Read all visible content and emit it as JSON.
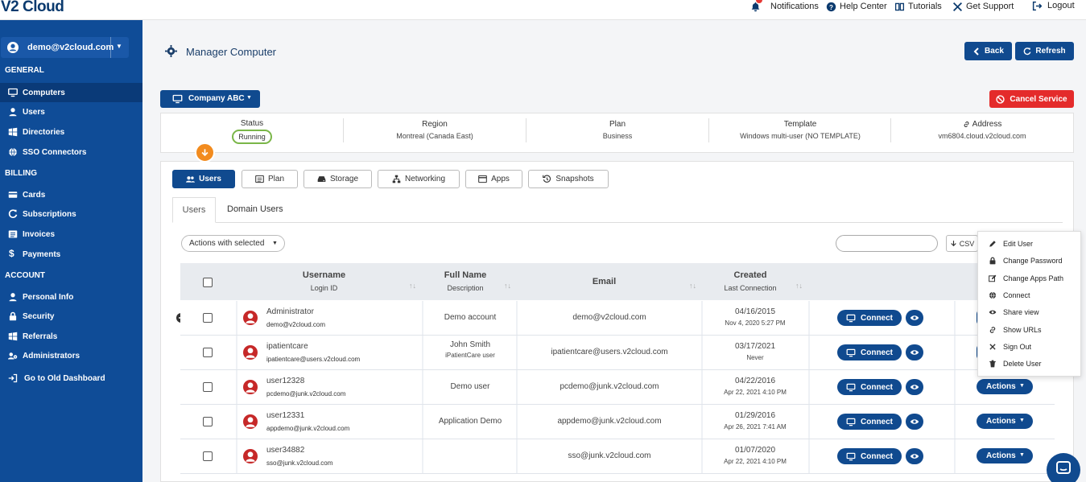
{
  "app": {
    "logo": "V2 Cloud"
  },
  "topnav": {
    "notifications": "Notifications",
    "help": "Help Center",
    "tutorials": "Tutorials",
    "support": "Get Support",
    "logout": "Logout"
  },
  "sidebar": {
    "account": "demo@v2cloud.com",
    "sections": {
      "general": "GENERAL",
      "billing": "BILLING",
      "account": "ACCOUNT"
    },
    "items": [
      {
        "label": "Computers",
        "icon": "monitor-icon",
        "active": true
      },
      {
        "label": "Users",
        "icon": "user-icon"
      },
      {
        "label": "Directories",
        "icon": "windows-icon"
      },
      {
        "label": "SSO Connectors",
        "icon": "globe-icon"
      },
      {
        "label": "Cards",
        "icon": "credit-card-icon"
      },
      {
        "label": "Subscriptions",
        "icon": "refresh-icon"
      },
      {
        "label": "Invoices",
        "icon": "list-icon"
      },
      {
        "label": "Payments",
        "icon": "dollar-icon"
      },
      {
        "label": "Personal Info",
        "icon": "user-icon"
      },
      {
        "label": "Security",
        "icon": "lock-icon"
      },
      {
        "label": "Referrals",
        "icon": "windows-icon"
      },
      {
        "label": "Administrators",
        "icon": "users-cog-icon"
      },
      {
        "label": "Go to Old Dashboard",
        "icon": "sign-in-icon"
      }
    ]
  },
  "header": {
    "title": "Manager Computer",
    "back": "Back",
    "refresh": "Refresh",
    "company": "Company ABC",
    "cancel": "Cancel Service"
  },
  "info": {
    "status_label": "Status",
    "status_value": "Running",
    "region_label": "Region",
    "region_value": "Montreal (Canada East)",
    "plan_label": "Plan",
    "plan_value": "Business",
    "template_label": "Template",
    "template_value": "Windows multi-user (NO TEMPLATE)",
    "address_label": "Address",
    "address_value": "vm6804.cloud.v2cloud.com"
  },
  "tabs": [
    "Users",
    "Plan",
    "Storage",
    "Networking",
    "Apps",
    "Snapshots"
  ],
  "subtabs": [
    "Users",
    "Domain Users"
  ],
  "toolbar": {
    "actions_selected": "Actions with selected",
    "csv": "CSV"
  },
  "table": {
    "headers": {
      "username": "Username",
      "login_id": "Login ID",
      "full_name": "Full Name",
      "description": "Description",
      "email": "Email",
      "created": "Created",
      "last_connection": "Last Connection"
    },
    "connect_label": "Connect",
    "actions_label": "Actions",
    "rows": [
      {
        "username": "Administrator",
        "login": "demo@v2cloud.com",
        "full_name": "Demo account",
        "description": "",
        "email": "demo@v2cloud.com",
        "created": "04/16/2015",
        "last": "Nov 4, 2020 5:27 PM"
      },
      {
        "username": "ipatientcare",
        "login": "ipatientcare@users.v2cloud.com",
        "full_name": "John Smith",
        "description": "iPatientCare user",
        "email": "ipatientcare@users.v2cloud.com",
        "created": "03/17/2021",
        "last": "Never"
      },
      {
        "username": "user12328",
        "login": "pcdemo@junk.v2cloud.com",
        "full_name": "Demo user",
        "description": "",
        "email": "pcdemo@junk.v2cloud.com",
        "created": "04/22/2016",
        "last": "Apr 22, 2021 4:10 PM"
      },
      {
        "username": "user12331",
        "login": "appdemo@junk.v2cloud.com",
        "full_name": "Application Demo",
        "description": "",
        "email": "appdemo@junk.v2cloud.com",
        "created": "01/29/2016",
        "last": "Apr 26, 2021 7:41 AM"
      },
      {
        "username": "user34882",
        "login": "sso@junk.v2cloud.com",
        "full_name": "",
        "description": "",
        "email": "sso@junk.v2cloud.com",
        "created": "01/07/2020",
        "last": "Apr 22, 2021 4:10 PM"
      }
    ]
  },
  "dropdown": {
    "items": [
      {
        "label": "Edit User",
        "icon": "pencil-icon"
      },
      {
        "label": "Change Password",
        "icon": "lock-icon"
      },
      {
        "label": "Change Apps Path",
        "icon": "edit-icon"
      },
      {
        "label": "Connect",
        "icon": "globe-icon"
      },
      {
        "label": "Share view",
        "icon": "eye-icon"
      },
      {
        "label": "Show URLs",
        "icon": "link-icon"
      },
      {
        "label": "Sign Out",
        "icon": "close-icon"
      },
      {
        "label": "Delete User",
        "icon": "trash-icon"
      }
    ]
  },
  "colors": {
    "sidebar": "#0f4c97",
    "primary": "#104a8f",
    "danger": "#e42b2b",
    "accent": "#f28b1e",
    "status_ok": "#7ab648"
  }
}
